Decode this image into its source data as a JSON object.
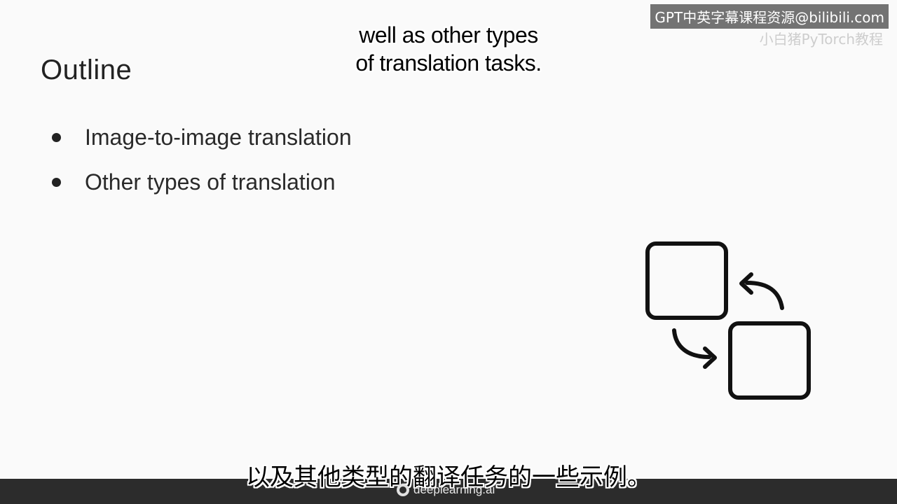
{
  "slide": {
    "title": "Outline",
    "bullets": [
      "Image-to-image translation",
      "Other types of translation"
    ]
  },
  "captions": {
    "english_line1": "well as other types",
    "english_line2": "of translation tasks.",
    "chinese": "以及其他类型的翻译任务的一些示例。"
  },
  "watermark": {
    "text": "GPT中英字幕课程资源@bilibili.com",
    "sub_text": "小白猪PyTorch教程"
  },
  "footer": {
    "brand": "deeplearning.ai"
  },
  "icons": {
    "translation": "translation-swap-icon"
  }
}
